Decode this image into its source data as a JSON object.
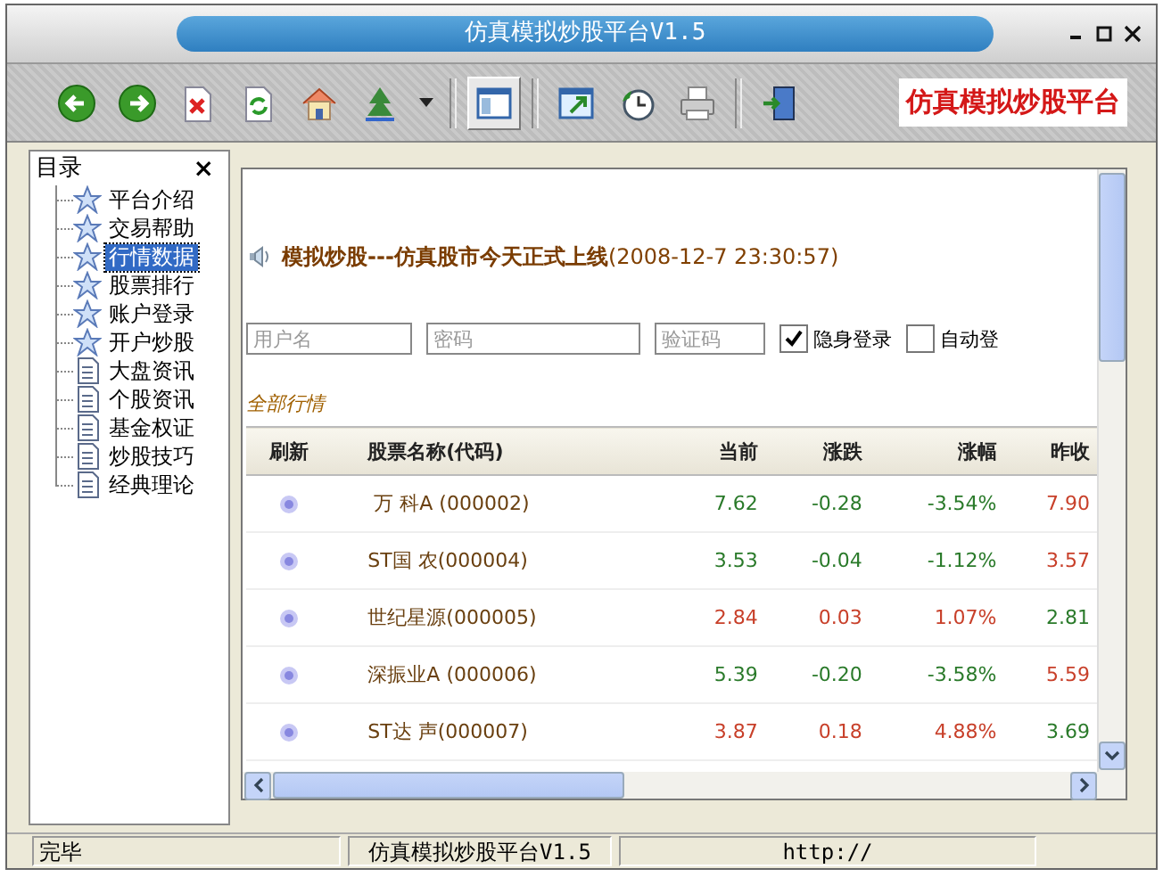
{
  "window": {
    "title": "仿真模拟炒股平台V1.5"
  },
  "toolbar": {
    "buttons": [
      {
        "kind": "back",
        "selected": false
      },
      {
        "kind": "forward",
        "selected": false
      },
      {
        "kind": "stop",
        "selected": false
      },
      {
        "kind": "refresh",
        "selected": false
      },
      {
        "kind": "home",
        "selected": false
      },
      {
        "kind": "tree",
        "selected": false
      },
      {
        "kind": "dropdown",
        "selected": false
      },
      {
        "kind": "panel",
        "selected": true
      },
      {
        "kind": "window",
        "selected": false
      },
      {
        "kind": "history",
        "selected": false
      },
      {
        "kind": "print",
        "selected": false
      },
      {
        "kind": "exit",
        "selected": false
      }
    ],
    "brand": "仿真模拟炒股平台"
  },
  "sidebar": {
    "title": "目录",
    "close": "×",
    "items": [
      {
        "label": "平台介绍",
        "kind": "star",
        "selected": false
      },
      {
        "label": "交易帮助",
        "kind": "star",
        "selected": false
      },
      {
        "label": "行情数据",
        "kind": "star",
        "selected": true
      },
      {
        "label": "股票排行",
        "kind": "star",
        "selected": false
      },
      {
        "label": "账户登录",
        "kind": "star",
        "selected": false
      },
      {
        "label": "开户炒股",
        "kind": "star",
        "selected": false
      },
      {
        "label": "大盘资讯",
        "kind": "page",
        "selected": false
      },
      {
        "label": "个股资讯",
        "kind": "page",
        "selected": false
      },
      {
        "label": "基金权证",
        "kind": "page",
        "selected": false
      },
      {
        "label": "炒股技巧",
        "kind": "page",
        "selected": false
      },
      {
        "label": "经典理论",
        "kind": "page",
        "selected": false
      }
    ]
  },
  "page": {
    "headline": "模拟炒股---仿真股市今天正式上线",
    "headline_time": "(2008-12-7 23:30:57)",
    "login": {
      "fields": [
        {
          "placeholder": "用户名"
        },
        {
          "placeholder": "密码"
        },
        {
          "placeholder": "验证码"
        }
      ],
      "options": [
        {
          "label": "隐身登录",
          "checked": true
        },
        {
          "label": "自动登",
          "checked": false
        }
      ]
    },
    "section_title": "全部行情",
    "table": {
      "columns": [
        "刷新",
        "股票名称(代码)",
        "当前",
        "涨跌",
        "涨幅",
        "昨收"
      ],
      "rows": [
        {
          "name": " 万 科A (000002)",
          "current": "7.62",
          "change": "-0.28",
          "pct": "-3.54%",
          "color": "#2a7a2a",
          "prev_close": {
            "value": "7.90",
            "color": "#c8402a"
          }
        },
        {
          "name": "ST国 农(000004)",
          "current": "3.53",
          "change": "-0.04",
          "pct": "-1.12%",
          "color": "#2a7a2a",
          "prev_close": {
            "value": "3.57",
            "color": "#c8402a"
          }
        },
        {
          "name": "世纪星源(000005)",
          "current": "2.84",
          "change": "0.03",
          "pct": "1.07%",
          "color": "#c8402a",
          "prev_close": {
            "value": "2.81",
            "color": "#2a7a2a"
          }
        },
        {
          "name": "深振业A (000006)",
          "current": "5.39",
          "change": "-0.20",
          "pct": "-3.58%",
          "color": "#2a7a2a",
          "prev_close": {
            "value": "5.59",
            "color": "#c8402a"
          }
        },
        {
          "name": "ST达 声(000007)",
          "current": "3.87",
          "change": "0.18",
          "pct": "4.88%",
          "color": "#c8402a",
          "prev_close": {
            "value": "3.69",
            "color": "#2a7a2a"
          }
        }
      ]
    }
  },
  "status_bar": [
    "完毕",
    "仿真模拟炒股平台V1.5",
    "http://"
  ]
}
